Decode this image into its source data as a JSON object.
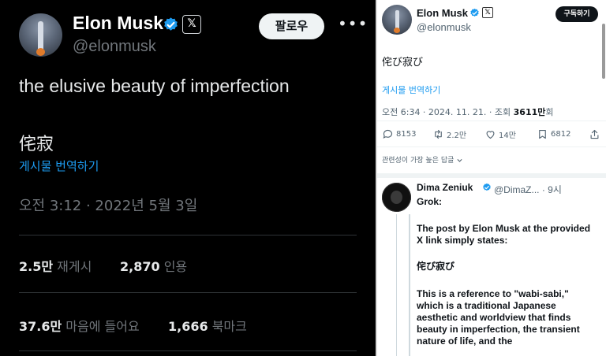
{
  "left": {
    "name": "Elon Musk",
    "x_badge": "𝕏",
    "handle": "@elonmusk",
    "follow_label": "팔로우",
    "more_label": "•••",
    "tweet_text": "the elusive beauty of imperfection",
    "tweet_kanji": "侘寂",
    "translate_label": "게시물 번역하기",
    "timestamp": "오전 3:12 · 2022년 5월 3일",
    "stats": [
      {
        "value": "2.5만",
        "label": "재게시"
      },
      {
        "value": "2,870",
        "label": "인용"
      },
      {
        "value": "37.6만",
        "label": "마음에 들어요"
      },
      {
        "value": "1,666",
        "label": "북마크"
      }
    ]
  },
  "right": {
    "name": "Elon Musk",
    "x_badge": "𝕏",
    "handle": "@elonmusk",
    "subscribe_label": "구독하기",
    "tweet_kanji": "侘び寂び",
    "translate_label": "게시물 번역하기",
    "timestamp_prefix": "오전 6:34 · 2024. 11. 21. · 조회 ",
    "views": "3611만",
    "views_suffix": "회",
    "actions": {
      "replies": "8153",
      "reposts": "2.2만",
      "likes": "14만",
      "bookmarks": "6812"
    },
    "sort_label": "관련성이 가장 높은 답글",
    "reply": {
      "name": "Dima Zeniuk",
      "handle": "@DimaZ... · 9시",
      "grok_label": "Grok:",
      "para1": "The post by Elon Musk at the provided X link simply states:",
      "para2": "侘び寂び",
      "para3": "This is a reference to \"wabi-sabi,\" which is a traditional Japanese aesthetic and worldview that finds beauty in imperfection, the transient nature of life, and the"
    }
  },
  "colors": {
    "verified": "#1d9bf0",
    "link": "#1d9bf0",
    "dark_bg": "#000000",
    "light_bg": "#ffffff"
  },
  "icons": [
    "verified-badge-icon",
    "x-logo-icon",
    "more-icon",
    "reply-icon",
    "repost-icon",
    "like-icon",
    "bookmark-icon",
    "share-icon",
    "chevron-down-icon"
  ]
}
